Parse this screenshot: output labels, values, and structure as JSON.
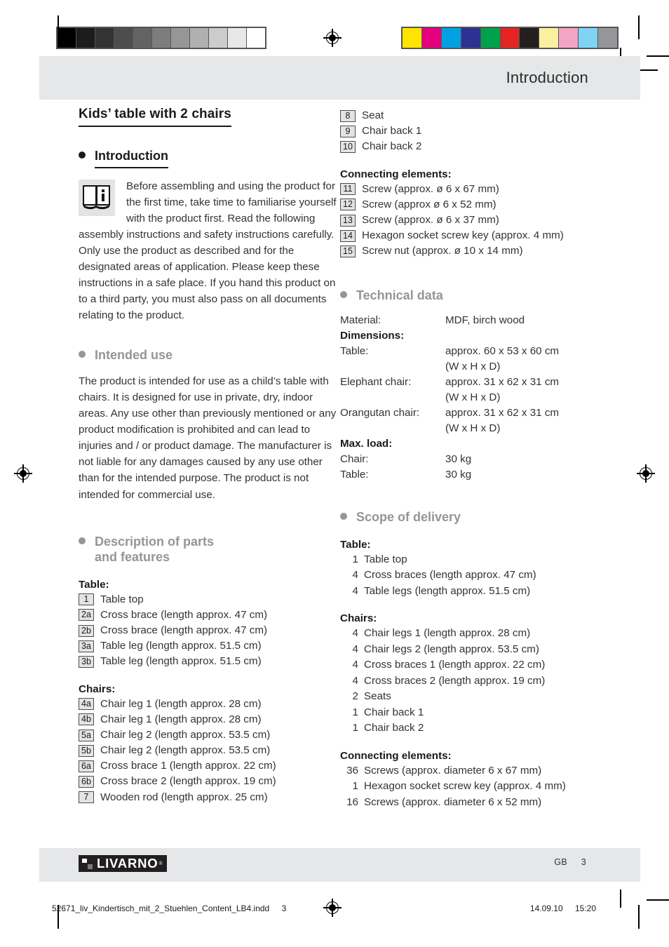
{
  "header": {
    "title": "Introduction"
  },
  "calibration": {
    "gray_strip": [
      "#000000",
      "#1c1c1c",
      "#333333",
      "#4d4d4d",
      "#636363",
      "#7d7d7d",
      "#969696",
      "#b0b0b0",
      "#cccccc",
      "#e8e8e8",
      "#ffffff"
    ],
    "color_strip": [
      "#ffe400",
      "#e6007e",
      "#00a0e3",
      "#2e3192",
      "#00a14b",
      "#e52421",
      "#231f20",
      "#fbf0a0",
      "#f4a4c4",
      "#7fd4f5",
      "#949699"
    ]
  },
  "doc": {
    "title": "Kids’ table with 2 chairs"
  },
  "introduction": {
    "heading": "Introduction",
    "icon_label": "info-book-icon",
    "paragraph": "Before assembling and using the product for the first time, take time to familiarise yourself with the product first. Read the following assembly instructions and safety instructions carefully. Only use the product as described and for the designated areas of application. Please keep these instructions in a safe place. If you hand this product on to a third party, you must also pass on all documents relating to the product."
  },
  "intended_use": {
    "heading": "Intended use",
    "paragraph": "The product is intended for use as a child’s table with chairs. It is designed for use in private, dry, indoor areas. Any use other than previously mentioned or any product modification is prohibited and can lead to injuries and / or product damage. The manufacturer is not liable for any damages caused by any use other than for the intended purpose. The product is not intended for commercial use."
  },
  "description": {
    "heading_line1": "Description of parts",
    "heading_line2": "and features",
    "table_label": "Table:",
    "table_parts": [
      {
        "num": "1",
        "text": "Table top"
      },
      {
        "num": "2a",
        "text": "Cross brace (length approx. 47 cm)"
      },
      {
        "num": "2b",
        "text": "Cross brace (length approx. 47 cm)"
      },
      {
        "num": "3a",
        "text": "Table leg (length approx. 51.5 cm)"
      },
      {
        "num": "3b",
        "text": "Table leg (length approx. 51.5 cm)"
      }
    ],
    "chairs_label": "Chairs:",
    "chairs_parts": [
      {
        "num": "4a",
        "text": "Chair leg 1 (length approx. 28 cm)"
      },
      {
        "num": "4b",
        "text": "Chair leg 1 (length approx. 28 cm)"
      },
      {
        "num": "5a",
        "text": "Chair leg 2 (length approx. 53.5 cm)"
      },
      {
        "num": "5b",
        "text": "Chair leg 2 (length approx. 53.5 cm)"
      },
      {
        "num": "6a",
        "text": "Cross brace 1 (length approx. 22 cm)"
      },
      {
        "num": "6b",
        "text": "Cross brace 2 (length approx. 19 cm)"
      },
      {
        "num": "7",
        "text": "Wooden rod (length approx. 25 cm)"
      }
    ],
    "chairs_parts_cont": [
      {
        "num": "8",
        "text": "Seat"
      },
      {
        "num": "9",
        "text": "Chair back 1"
      },
      {
        "num": "10",
        "text": "Chair back 2"
      }
    ],
    "connecting_label": "Connecting elements:",
    "connecting_parts": [
      {
        "num": "11",
        "text": "Screw (approx. ø 6 x 67 mm)"
      },
      {
        "num": "12",
        "text": "Screw (approx ø 6 x 52 mm)"
      },
      {
        "num": "13",
        "text": "Screw (approx. ø 6 x 37 mm)"
      },
      {
        "num": "14",
        "text": "Hexagon socket screw key (approx. 4 mm)"
      },
      {
        "num": "15",
        "text": "Screw nut (approx. ø 10 x 14 mm)"
      }
    ]
  },
  "technical_data": {
    "heading": "Technical data",
    "rows": [
      {
        "label": "Material:",
        "value": "MDF, birch wood",
        "bold": false
      },
      {
        "label": "Dimensions:",
        "value": "",
        "bold": true
      },
      {
        "label": "Table:",
        "value": "approx. 60 x 53 x 60 cm\n(W x H x D)",
        "bold": false
      },
      {
        "label": "Elephant chair:",
        "value": "approx. 31 x 62 x 31 cm\n(W x H x D)",
        "bold": false
      },
      {
        "label": "Orangutan chair:",
        "value": "approx. 31 x 62 x 31 cm\n(W x H x D)",
        "bold": false
      },
      {
        "label": "Max. load:",
        "value": "",
        "bold": true
      },
      {
        "label": "Chair:",
        "value": "30 kg",
        "bold": false
      },
      {
        "label": "Table:",
        "value": "30 kg",
        "bold": false
      }
    ]
  },
  "scope_of_delivery": {
    "heading": "Scope of delivery",
    "table_label": "Table:",
    "table_items": [
      {
        "qty": "1",
        "text": "Table top"
      },
      {
        "qty": "4",
        "text": "Cross braces (length approx. 47 cm)"
      },
      {
        "qty": "4",
        "text": "Table legs (length approx. 51.5 cm)"
      }
    ],
    "chairs_label": "Chairs:",
    "chairs_items": [
      {
        "qty": "4",
        "text": "Chair legs 1 (length approx. 28 cm)"
      },
      {
        "qty": "4",
        "text": "Chair legs 2 (length approx. 53.5 cm)"
      },
      {
        "qty": "4",
        "text": "Cross braces 1 (length approx. 22 cm)"
      },
      {
        "qty": "4",
        "text": "Cross braces 2 (length approx. 19 cm)"
      },
      {
        "qty": "2",
        "text": "Seats"
      },
      {
        "qty": "1",
        "text": "Chair back 1"
      },
      {
        "qty": "1",
        "text": "Chair back 2"
      }
    ],
    "connecting_label": "Connecting elements:",
    "connecting_items": [
      {
        "qty": "36",
        "text": "Screws (approx. diameter 6 x 67 mm)"
      },
      {
        "qty": "1",
        "text": "Hexagon socket screw key (approx. 4 mm)"
      },
      {
        "qty": "16",
        "text": "Screws (approx. diameter 6 x 52 mm)"
      }
    ]
  },
  "footer": {
    "brand": "LIVARNO",
    "brand_reg": "®",
    "country_code": "GB",
    "page_number": "3",
    "print_file": "52671_liv_Kindertisch_mit_2_Stuehlen_Content_LB4.indd",
    "print_page": "3",
    "print_date": "14.09.10",
    "print_time": "15:20"
  }
}
